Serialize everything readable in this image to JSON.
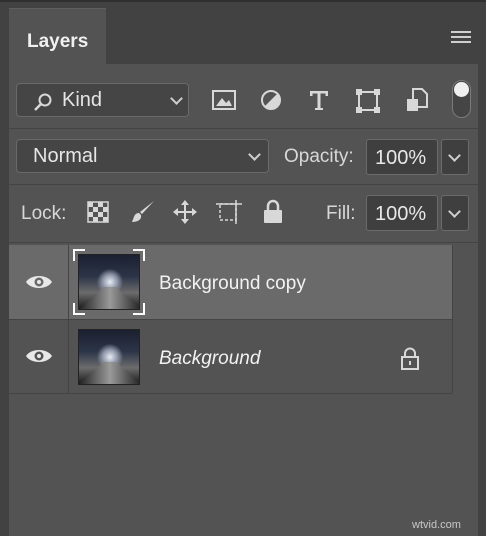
{
  "panel": {
    "tab_title": "Layers",
    "filter": {
      "kind_label": "Kind",
      "icons": [
        "image-filter-icon",
        "adjustment-filter-icon",
        "type-filter-icon",
        "shape-filter-icon",
        "smart-object-filter-icon"
      ]
    },
    "blend_mode": "Normal",
    "opacity_label": "Opacity:",
    "opacity_value": "100%",
    "lock_label": "Lock:",
    "fill_label": "Fill:",
    "fill_value": "100%"
  },
  "layers": [
    {
      "name": "Background copy",
      "selected": true,
      "visible": true,
      "locked": false
    },
    {
      "name": "Background",
      "selected": false,
      "visible": true,
      "locked": true
    }
  ],
  "watermark": "wtvid.com"
}
